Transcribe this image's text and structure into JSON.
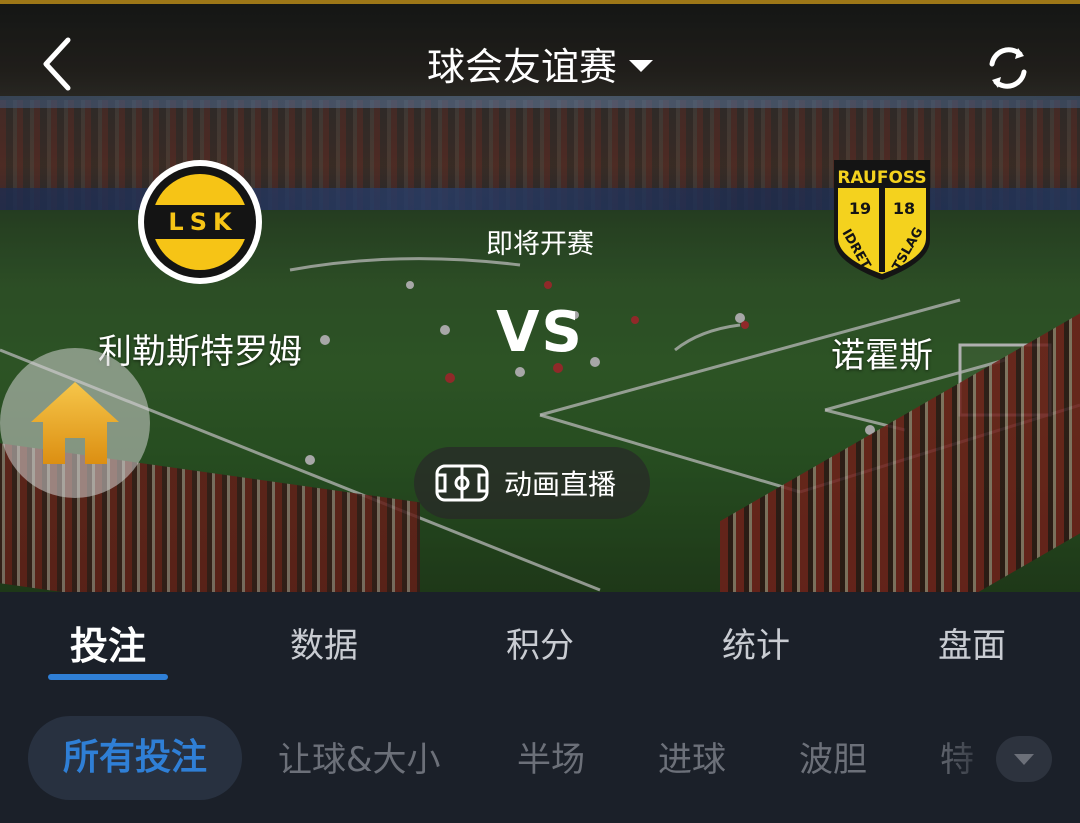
{
  "header": {
    "title": "球会友谊赛",
    "back_icon": "chevron-left-icon",
    "refresh_icon": "refresh-icon"
  },
  "match": {
    "status": "即将开赛",
    "vs": "VS",
    "home_team": {
      "name": "利勒斯特罗姆",
      "logo_text": "LSK"
    },
    "away_team": {
      "name": "诺霍斯",
      "logo_top": "RAUFOSS",
      "logo_year_left": "19",
      "logo_year_right": "18",
      "logo_word_left": "IDRET",
      "logo_word_right": "TSLAG"
    },
    "live_button": "动画直播"
  },
  "tabs": [
    {
      "label": "投注",
      "active": true
    },
    {
      "label": "数据",
      "active": false
    },
    {
      "label": "积分",
      "active": false
    },
    {
      "label": "统计",
      "active": false
    },
    {
      "label": "盘面",
      "active": false
    }
  ],
  "filters": [
    {
      "label": "所有投注",
      "active": true
    },
    {
      "label": "让球&大小",
      "active": false
    },
    {
      "label": "半场",
      "active": false
    },
    {
      "label": "进球",
      "active": false
    },
    {
      "label": "波胆",
      "active": false
    },
    {
      "label": "特",
      "active": false
    }
  ],
  "colors": {
    "accent": "#2f7fd6",
    "background": "#1b2029",
    "lsk_yellow": "#f6c416",
    "raufoss_yellow": "#f4d21e",
    "home_fab": "#e8a21c"
  }
}
